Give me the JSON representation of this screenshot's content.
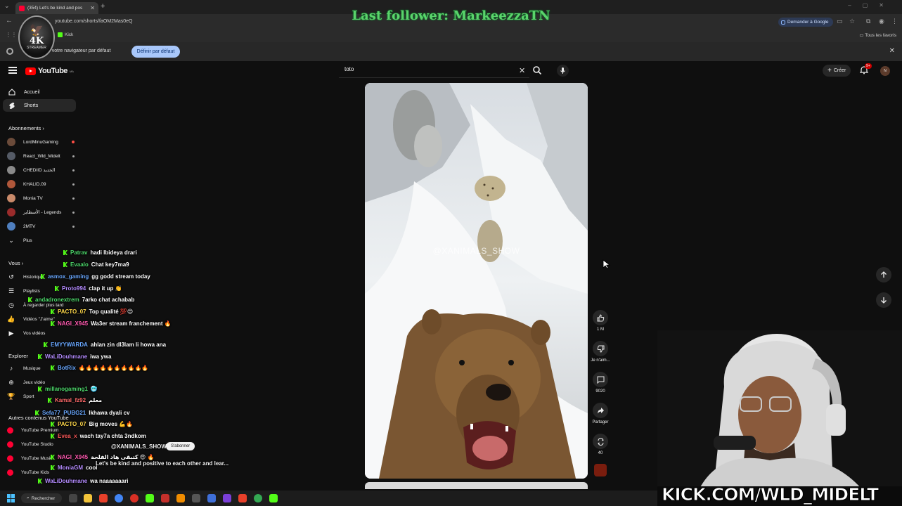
{
  "browser": {
    "tab_title": "(354) Let's be kind and pos",
    "url": "youtube.com/shorts/faOM2Mas0eQ",
    "google_button": "Demander à Google",
    "bookmark_kick": "Kick",
    "bookmark_all": "Tous les favoris",
    "default_msg": "n'est pas votre navigateur par défaut",
    "default_btn": "Définir par défaut"
  },
  "stream_overlay": {
    "last_follower": "Last follower: MarkeezzaTN",
    "logo_text": "4K",
    "logo_sub": "STREAMER",
    "kick_url": "KICK.COM/WLD_MIDELT"
  },
  "youtube": {
    "search_value": "toto",
    "create_label": "Créer",
    "notif_badge": "9+",
    "avatar_initials": "N",
    "sidebar": {
      "home": "Accueil",
      "shorts": "Shorts",
      "subscriptions_header": "Abonnements",
      "subscriptions": [
        {
          "name": "LordMinuGaming",
          "color": "#6b4b3a",
          "status": "live"
        },
        {
          "name": "React_Wld_Midelt",
          "color": "#555b66",
          "status": "dot"
        },
        {
          "name": "CHEDIID الخديد",
          "color": "#8a8a8a",
          "status": "dot"
        },
        {
          "name": "KHALID.09",
          "color": "#b0573a",
          "status": "dot"
        },
        {
          "name": "Monia TV",
          "color": "#c98a6a",
          "status": "dot"
        },
        {
          "name": "الأسطاير - Legends",
          "color": "#9a2b2b",
          "status": "dot"
        },
        {
          "name": "2MTV",
          "color": "#4f7fbf",
          "status": "dot"
        }
      ],
      "more": "Plus",
      "you_header": "Vous",
      "history": "Historique",
      "playlists": "Playlists",
      "watch_later": "À regarder plus tard",
      "liked": "Vidéos \"J'aime\"",
      "your_videos": "Vos vidéos",
      "explore_header": "Explorer",
      "music": "Musique",
      "games": "Jeux vidéo",
      "sport": "Sport",
      "other_header": "Autres contenus YouTube",
      "premium": "YouTube Premium",
      "studio": "YouTube Studio",
      "music_app": "YouTube Music",
      "kids": "YouTube Kids"
    },
    "short": {
      "watermark": "@XANIMALS_SHOW",
      "channel": "@XANIMALS_SHOW",
      "subscribe": "S'abonner",
      "caption": "Let's be kind and positive to each other and lear...",
      "likes": "1 M",
      "dislike": "Je n'aim...",
      "comments": "9020",
      "share": "Partager",
      "remix": "40"
    }
  },
  "chat": [
    {
      "user": "Patrav",
      "color": "#4dd86b",
      "msg": "hadi lbideya drari"
    },
    {
      "user": "Evaalo",
      "color": "#4dd86b",
      "msg": "Chat key7ma9"
    },
    {
      "user": "asmox_gaming",
      "color": "#6aa8ff",
      "msg": "gg godd stream today"
    },
    {
      "user": "Proto994",
      "color": "#b58cff",
      "msg": "clap it up 👏"
    },
    {
      "user": "andadronextrem",
      "color": "#4dd86b",
      "msg": "7arko chat achabab"
    },
    {
      "user": "PACTO_07",
      "color": "#ffd84a",
      "msg": "Top qualité 💯😍"
    },
    {
      "user": "NAGI_X945",
      "color": "#ff5ab0",
      "msg": "Wa3er stream franchement 🔥"
    },
    {
      "user": "EMYYWARDA",
      "color": "#6aa8ff",
      "msg": "ahlan zin dl3lam li howa ana"
    },
    {
      "user": "WaLiDouhmane",
      "color": "#b58cff",
      "msg": "iwa ywa"
    },
    {
      "user": "BotRix",
      "color": "#6aa8ff",
      "msg": "🔥🔥🔥🔥🔥🔥🔥🔥🔥🔥"
    },
    {
      "user": "millanogaming1",
      "color": "#4dd86b",
      "msg": "🥶"
    },
    {
      "user": "Kamal_fz92",
      "color": "#ff6a6a",
      "msg": "معلم"
    },
    {
      "user": "Sefa77_PUBG21",
      "color": "#6aa8ff",
      "msg": "lkhawa dyali cv"
    },
    {
      "user": "PACTO_07",
      "color": "#ffd84a",
      "msg": "Big moves 💪🔥"
    },
    {
      "user": "Evea_x",
      "color": "#ff5a5a",
      "msg": "wach tay7a chta 3ndkom"
    },
    {
      "user": "NAGI_X945",
      "color": "#ff5ab0",
      "msg": "كتبقى هاد الفلحة 😍 🔥"
    },
    {
      "user": "MoniaGM",
      "color": "#b58cff",
      "msg": "cool"
    },
    {
      "user": "WaLiDouhmane",
      "color": "#b58cff",
      "msg": "wa naaaaaaari"
    }
  ],
  "taskbar": {
    "search_label": "Rechercher"
  },
  "icons": [
    "hamburger-icon",
    "youtube-logo-icon",
    "search-icon",
    "mic-icon",
    "bell-icon",
    "like-icon",
    "dislike-icon",
    "comment-icon",
    "share-icon",
    "remix-icon",
    "arrow-up-icon",
    "arrow-down-icon",
    "kick-logo-icon",
    "windows-icon"
  ]
}
